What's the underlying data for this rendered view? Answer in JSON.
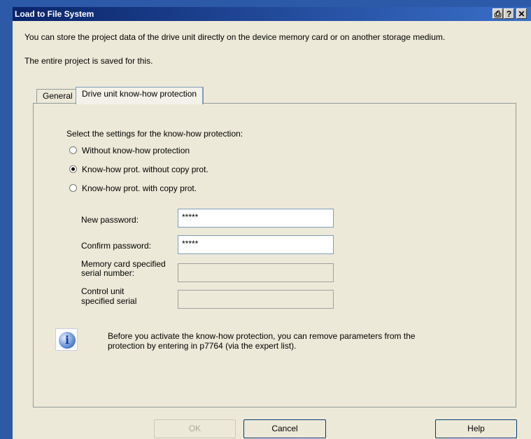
{
  "window": {
    "title": "Load to File System"
  },
  "titlebar_buttons": [
    {
      "name": "print-icon",
      "glyph": "⎙"
    },
    {
      "name": "help-icon",
      "glyph": "?"
    },
    {
      "name": "close-icon",
      "glyph": "✕"
    }
  ],
  "intro": {
    "line1": "You can store the project data of the drive unit directly on the device memory card or on another storage medium.",
    "line2": "The entire project is saved for this."
  },
  "tabs": [
    {
      "label": "General",
      "active": false
    },
    {
      "label": "Drive unit know-how protection",
      "active": true
    }
  ],
  "protection": {
    "heading": "Select the settings for the know-how protection:",
    "options": [
      {
        "label": "Without know-how protection",
        "selected": false
      },
      {
        "label": "Know-how prot. without copy prot.",
        "selected": true
      },
      {
        "label": "Know-how prot. with copy prot.",
        "selected": false
      }
    ]
  },
  "fields": {
    "new_password": {
      "label": "New password:",
      "value": "*****"
    },
    "confirm_password": {
      "label": "Confirm password:",
      "value": "*****"
    },
    "memory_card_serial": {
      "label_line1": "Memory card specified",
      "label_line2": "serial number:",
      "value": ""
    },
    "control_unit_serial": {
      "label_line1": "Control unit",
      "label_line2": "specified serial",
      "value": ""
    }
  },
  "info": {
    "line1": "Before you activate the know-how protection, you can remove parameters from the",
    "line2": "protection by entering in p7764 (via the expert list)."
  },
  "buttons": {
    "ok": "OK",
    "cancel": "Cancel",
    "help": "Help"
  }
}
